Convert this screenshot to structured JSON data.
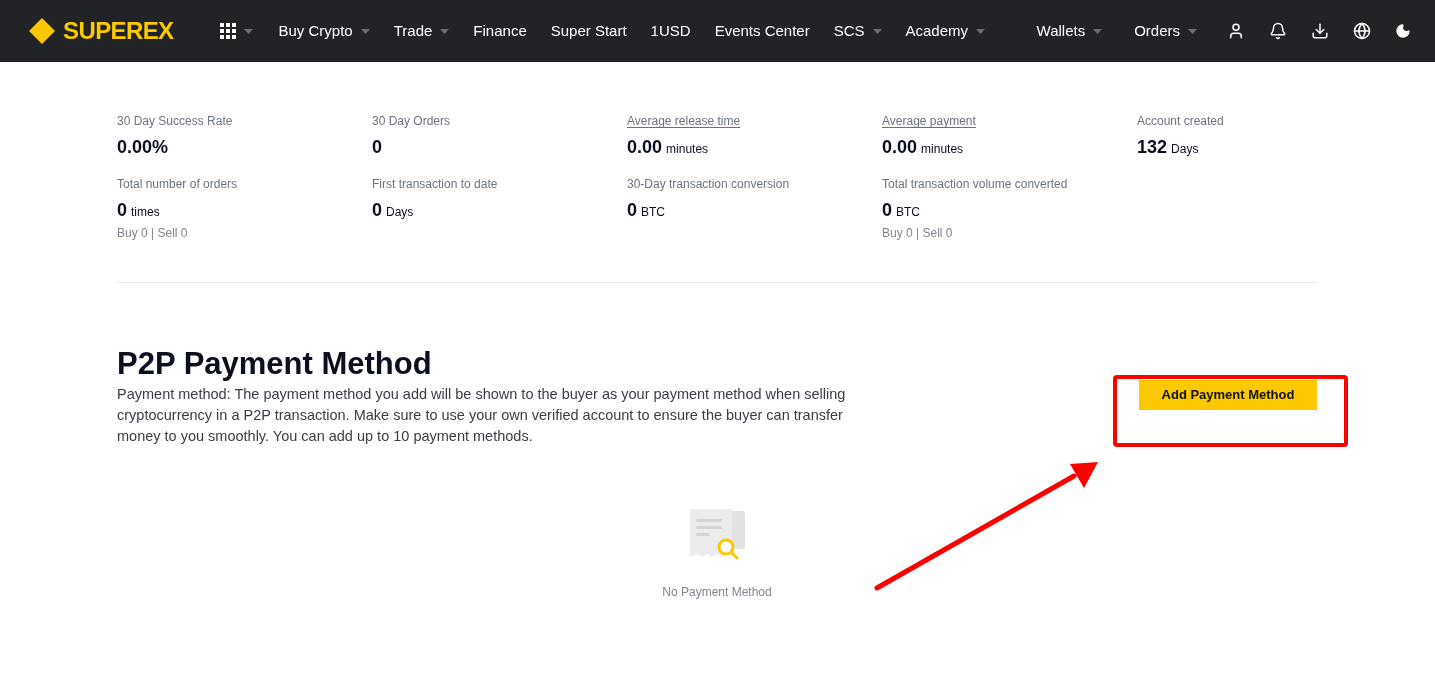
{
  "header": {
    "logo": "SUPEREX",
    "nav": [
      {
        "label": "Buy Crypto",
        "dropdown": true
      },
      {
        "label": "Trade",
        "dropdown": true
      },
      {
        "label": "Finance",
        "dropdown": false
      },
      {
        "label": "Super Start",
        "dropdown": false
      },
      {
        "label": "1USD",
        "dropdown": false
      },
      {
        "label": "Events Center",
        "dropdown": false
      },
      {
        "label": "SCS",
        "dropdown": true
      },
      {
        "label": "Academy",
        "dropdown": true
      }
    ],
    "right_nav": [
      {
        "label": "Wallets",
        "dropdown": true
      },
      {
        "label": "Orders",
        "dropdown": true
      }
    ]
  },
  "stats": [
    {
      "label": "30 Day Success Rate",
      "underlined": false,
      "value": "0.00%"
    },
    {
      "label": "30 Day Orders",
      "underlined": false,
      "value": "0"
    },
    {
      "label": "Average release time",
      "underlined": true,
      "value": "0.00",
      "unit": "minutes"
    },
    {
      "label": "Average payment",
      "underlined": true,
      "value": "0.00",
      "unit": "minutes"
    },
    {
      "label": "Account created",
      "underlined": false,
      "value": "132",
      "unit": "Days"
    },
    {
      "label": "Total number of orders",
      "underlined": false,
      "value": "0",
      "unit": "times",
      "sub": "Buy 0 | Sell 0"
    },
    {
      "label": "First transaction to date",
      "underlined": false,
      "value": "0",
      "unit": "Days"
    },
    {
      "label": "30-Day transaction conversion",
      "underlined": false,
      "value": "0",
      "unit": "BTC"
    },
    {
      "label": "Total transaction volume converted",
      "underlined": false,
      "value": "0",
      "unit": "BTC",
      "sub": "Buy 0 | Sell 0"
    }
  ],
  "payment": {
    "title": "P2P Payment Method",
    "description": "Payment method: The payment method you add will be shown to the buyer as your payment method when selling cryptocurrency in a P2P transaction. Make sure to use your own verified account to ensure the buyer can transfer money to you smoothly. You can add up to 10 payment methods.",
    "button": "Add Payment Method",
    "empty_text": "No Payment Method"
  }
}
